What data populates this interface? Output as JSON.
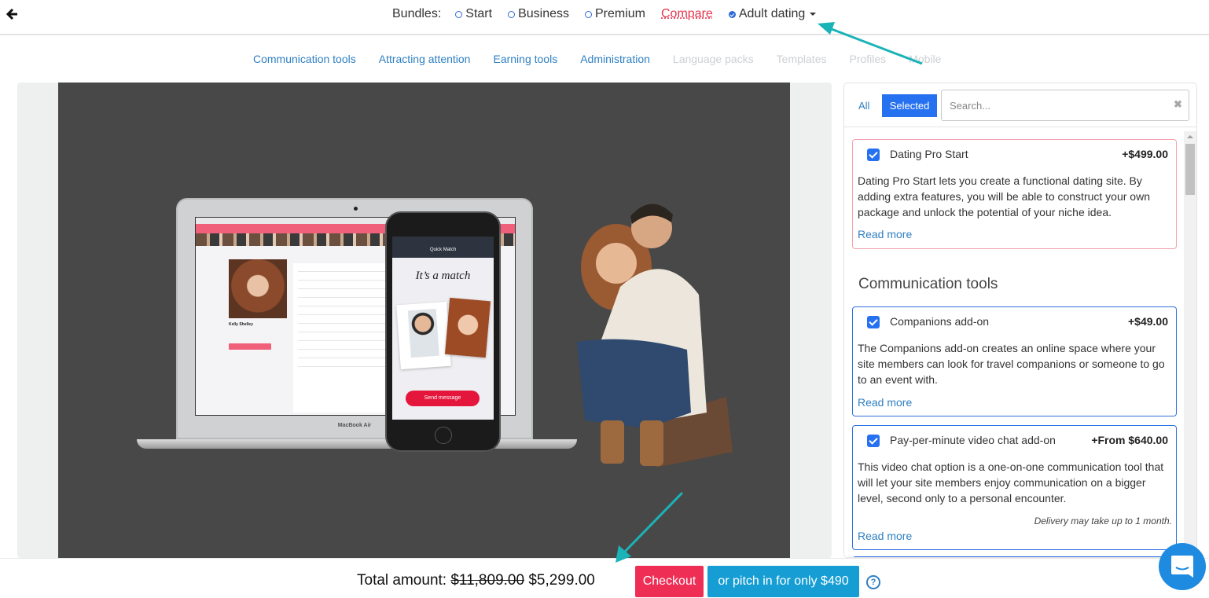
{
  "header": {
    "back_icon": "arrow-left-icon",
    "bundles_label": "Bundles:",
    "bundles": [
      {
        "label": "Start",
        "checked": false
      },
      {
        "label": "Business",
        "checked": false
      },
      {
        "label": "Premium",
        "checked": false
      }
    ],
    "compare_label": "Compare",
    "selected_bundle": {
      "label": "Adult dating",
      "checked": true
    }
  },
  "category_nav": [
    {
      "label": "Communication tools",
      "enabled": true
    },
    {
      "label": "Attracting attention",
      "enabled": true
    },
    {
      "label": "Earning tools",
      "enabled": true
    },
    {
      "label": "Administration",
      "enabled": true
    },
    {
      "label": "Language packs",
      "enabled": false
    },
    {
      "label": "Templates",
      "enabled": false
    },
    {
      "label": "Profiles",
      "enabled": false
    },
    {
      "label": "Mobile",
      "enabled": false
    }
  ],
  "hero": {
    "laptop_label": "MacBook Air",
    "laptop_profile_name": "Kelly Shelley",
    "phone_header": "Quick Match",
    "phone_title": "It’s a match",
    "phone_button": "Send message"
  },
  "panel": {
    "tabs": [
      {
        "label": "All",
        "active": false
      },
      {
        "label": "Selected",
        "active": true
      }
    ],
    "search": {
      "value": "",
      "placeholder": "Search..."
    },
    "clear_icon": "close-icon",
    "items": [
      {
        "title": "Dating Pro Start",
        "price": "+$499.00",
        "checked": true,
        "description": "Dating Pro Start lets you create a functional dating site. By adding extra features, you will be able to construct your own package and unlock the potential of your niche idea.",
        "read_more": "Read more"
      }
    ],
    "sections": [
      {
        "title": "Communication tools",
        "items": [
          {
            "title": "Companions add-on",
            "price": "+$49.00",
            "checked": true,
            "description": "The Companions add-on creates an online space where your site members can look for travel companions or someone to go to an event with.",
            "read_more": "Read more"
          },
          {
            "title": "Pay-per-minute video chat add-on",
            "price": "+From $640.00",
            "checked": true,
            "description": "This video chat option is a one-on-one communication tool that will let your site members enjoy communication on a bigger level, second only to a personal encounter.",
            "note": "Delivery may take up to 1 month.",
            "read_more": "Read more"
          }
        ]
      }
    ]
  },
  "footer": {
    "total_label": "Total amount:",
    "old_price": "$11,809.00",
    "new_price": "$5,299.00",
    "checkout_label": "Checkout",
    "pitch_label": "or pitch in for only $490",
    "help_label": "?"
  },
  "colors": {
    "accent_blue": "#2671f0",
    "link_blue": "#2f7fc1",
    "checkout_red": "#ef2e56",
    "pitch_blue": "#169ed4",
    "annotation_teal": "#1ab3b8"
  }
}
